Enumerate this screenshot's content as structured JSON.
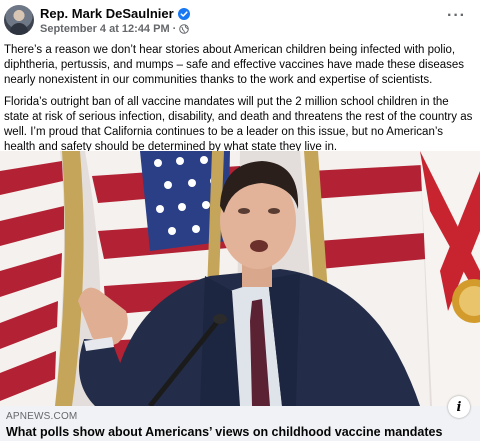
{
  "post": {
    "author": "Rep. Mark DeSaulnier",
    "timestamp": "September 4 at 12:44 PM",
    "separator": "·",
    "more_label": "···",
    "paragraphs": [
      "There’s a reason we don’t hear stories about American children being infected with polio, diphtheria, pertussis, and mumps – safe and effective vaccines have made these diseases nearly nonexistent in our communities thanks to the work and expertise of scientists.",
      "Florida’s outright ban of all vaccine mandates will put the 2 million school children in the state at risk of serious infection, disability, and death and threatens the rest of the country as well. I’m proud that California continues to be a leader on this issue, but no American’s health and safety should be determined by what state they live in."
    ]
  },
  "link_preview": {
    "domain": "APNEWS.COM",
    "headline": "What polls show about Americans’ views on childhood vaccine mandates",
    "info_label": "i"
  },
  "colors": {
    "verified_blue": "#1877f2",
    "secondary_text": "#65676b",
    "link_bar_bg": "#f0f2f5"
  },
  "icons": {
    "verified": "verified-badge-icon",
    "audience": "globe-icon",
    "more": "more-options-icon",
    "info": "info-icon"
  }
}
